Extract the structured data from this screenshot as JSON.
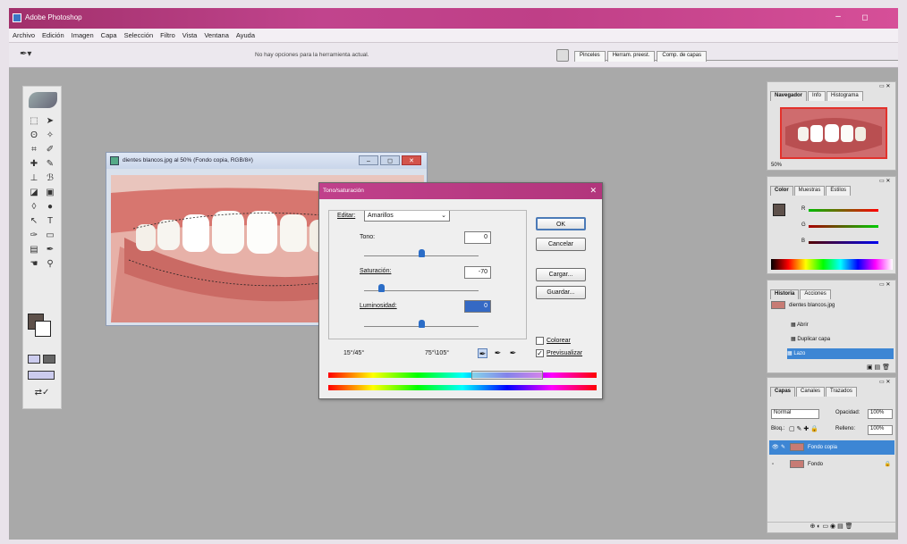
{
  "app": {
    "title": "Adobe Photoshop",
    "min_glyph": "–",
    "max_glyph": "◻"
  },
  "menu": [
    "Archivo",
    "Edición",
    "Imagen",
    "Capa",
    "Selección",
    "Filtro",
    "Vista",
    "Ventana",
    "Ayuda"
  ],
  "options_bar": {
    "hint": "No hay opciones para la herramienta actual.",
    "tabs": [
      "Pinceles",
      "Herram. preest.",
      "Comp. de capas"
    ]
  },
  "document": {
    "title": "dientes blancos.jpg al 50% (Fondo copia, RGB/8#)"
  },
  "dialog": {
    "title": "Tono/saturación",
    "edit_label": "Editar:",
    "edit_value": "Amarillos",
    "hue_label": "Tono:",
    "hue_value": "0",
    "sat_label": "Saturación:",
    "sat_value": "-70",
    "light_label": "Luminosidad:",
    "light_value": "0",
    "range_left": "15°/45°",
    "range_right": "75°\\105°",
    "ok": "OK",
    "cancel": "Cancelar",
    "load": "Cargar...",
    "save": "Guardar...",
    "colorize_label": "Colorear",
    "preview_label": "Previsualizar",
    "preview_checked": "✓",
    "slider_levels": {
      "hue": 0.5,
      "saturation": 0.15,
      "lightness": 0.5
    }
  },
  "navigator": {
    "tabs": [
      "Navegador",
      "Info",
      "Histograma"
    ],
    "zoom": "50%"
  },
  "color_panel": {
    "tabs": [
      "Color",
      "Muestras",
      "Estilos"
    ],
    "channels": [
      "R",
      "G",
      "B"
    ]
  },
  "history": {
    "tabs": [
      "Historia",
      "Acciones"
    ],
    "items": [
      "dientes blancos.jpg",
      "Abrir",
      "Duplicar capa",
      "Lazo"
    ]
  },
  "layers": {
    "tabs": [
      "Capas",
      "Canales",
      "Trazados"
    ],
    "blend_mode": "Normal",
    "opacity_label": "Opacidad:",
    "opacity_value": "100%",
    "lock_label": "Bloq.:",
    "fill_label": "Relleno:",
    "fill_value": "100%",
    "items": [
      "Fondo copia",
      "Fondo"
    ]
  },
  "colors": {
    "title_bar": "#b93c82",
    "workspace": "#a9a9a9",
    "selection": "#3d86d4",
    "foreground": "#5e514b"
  }
}
